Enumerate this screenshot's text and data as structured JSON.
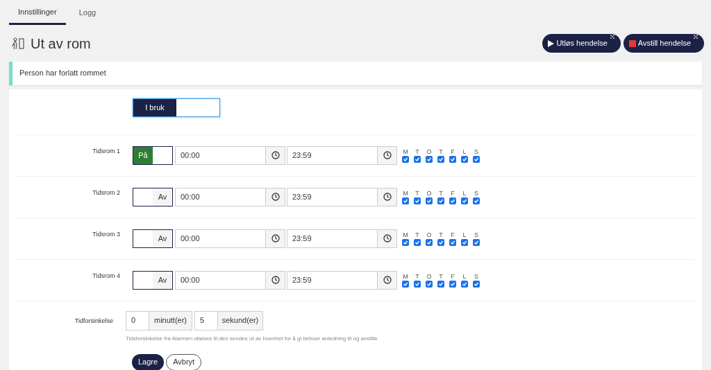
{
  "tabs": [
    {
      "label": "Innstillinger",
      "selected": true
    },
    {
      "label": "Logg",
      "selected": false
    }
  ],
  "title": "Ut av rom",
  "actions": [
    {
      "kind": "play",
      "label": "Utløs hendelse"
    },
    {
      "kind": "stop",
      "label": "Avstill hendelse"
    }
  ],
  "notice": "Person har forlatt rommet",
  "status_toggle": {
    "label": "I bruk",
    "on": true
  },
  "periods": [
    {
      "label": "Tidsrom 1",
      "toggle": {
        "label": "På",
        "on": true
      },
      "start": "00:00",
      "end": "23:59",
      "days": [
        {
          "letter": "M",
          "checked": true
        },
        {
          "letter": "T",
          "checked": true
        },
        {
          "letter": "O",
          "checked": true
        },
        {
          "letter": "T",
          "checked": true
        },
        {
          "letter": "F",
          "checked": true
        },
        {
          "letter": "L",
          "checked": true
        },
        {
          "letter": "S",
          "checked": true
        }
      ]
    },
    {
      "label": "Tidsrom 2",
      "toggle": {
        "label": "Av",
        "on": false
      },
      "start": "00:00",
      "end": "23:59",
      "days": [
        {
          "letter": "M",
          "checked": true
        },
        {
          "letter": "T",
          "checked": true
        },
        {
          "letter": "O",
          "checked": true
        },
        {
          "letter": "T",
          "checked": true
        },
        {
          "letter": "F",
          "checked": true
        },
        {
          "letter": "L",
          "checked": true
        },
        {
          "letter": "S",
          "checked": true
        }
      ]
    },
    {
      "label": "Tidsrom 3",
      "toggle": {
        "label": "Av",
        "on": false
      },
      "start": "00:00",
      "end": "23:59",
      "days": [
        {
          "letter": "M",
          "checked": true
        },
        {
          "letter": "T",
          "checked": true
        },
        {
          "letter": "O",
          "checked": true
        },
        {
          "letter": "T",
          "checked": true
        },
        {
          "letter": "F",
          "checked": true
        },
        {
          "letter": "L",
          "checked": true
        },
        {
          "letter": "S",
          "checked": true
        }
      ]
    },
    {
      "label": "Tidsrom 4",
      "toggle": {
        "label": "Av",
        "on": false
      },
      "start": "00:00",
      "end": "23:59",
      "days": [
        {
          "letter": "M",
          "checked": true
        },
        {
          "letter": "T",
          "checked": true
        },
        {
          "letter": "O",
          "checked": true
        },
        {
          "letter": "T",
          "checked": true
        },
        {
          "letter": "F",
          "checked": true
        },
        {
          "letter": "L",
          "checked": true
        },
        {
          "letter": "S",
          "checked": true
        }
      ]
    }
  ],
  "delay": {
    "label": "Tidforsinkelse",
    "minutes": "0",
    "minutes_unit": "minutt(er)",
    "seconds": "5",
    "seconds_unit": "sekund(er)",
    "help": "Tidsforsinkelse fra Alarmen utløses til den sendes ut av boenhet for å gi beboer anledning til og avstille"
  },
  "buttons": [
    {
      "kind": "primary",
      "label": "Lagre"
    },
    {
      "kind": "secondary",
      "label": "Avbryt"
    }
  ]
}
